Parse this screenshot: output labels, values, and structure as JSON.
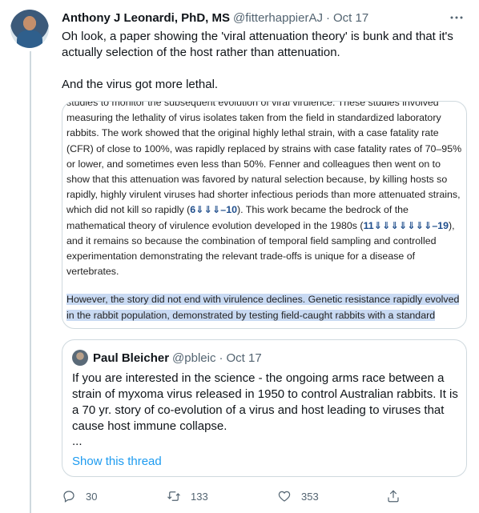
{
  "tweet": {
    "author_name": "Anthony J Leonardi, PhD, MS",
    "author_handle": "@fitterhappierAJ",
    "separator": "·",
    "date": "Oct 17",
    "text_line1": "Oh look, a paper showing the 'viral attenuation theory' is bunk and that it's actually selection of the host rather than attenuation.",
    "text_line2": "And the virus got more lethal."
  },
  "media": {
    "cut_line": "studies to monitor the subsequent evolution of viral virulence. These studies involved",
    "p1_a": "measuring the lethality of virus isolates taken from the field in standardized laboratory rabbits. The work showed that the original highly lethal strain, with a case fatality rate (CFR) of close to 100%, was rapidly replaced by strains with case fatality rates of 70–95% or lower, and sometimes even less than 50%. Fenner and colleagues then went on to show that this attenuation was favored by natural selection because, by killing hosts so rapidly, highly virulent viruses had shorter infectious periods than more attenuated strains, which did not kill so rapidly (",
    "cite1": "6⇓⇓⇓–10",
    "p1_b": "). This work became the bedrock of the mathematical theory of virulence evolution developed in the 1980s (",
    "cite2": "11⇓⇓⇓⇓⇓⇓⇓–19",
    "p1_c": "), and it remains so because the combination of temporal field sampling and controlled experimentation demonstrating the relevant trade-offs is unique for a disease of vertebrates.",
    "p2_highlight": "However, the story did not end with virulence declines. Genetic resistance rapidly evolved in the rabbit population, demonstrated by testing field-caught rabbits with a standard"
  },
  "quote": {
    "author_name": "Paul Bleicher",
    "author_handle": "@pbleic",
    "separator": "·",
    "date": "Oct 17",
    "text": "If you are interested in the science - the ongoing arms race between a strain of myxoma virus released in 1950 to control Australian rabbits.  It is a 70 yr. story of co-evolution of a virus and host leading to viruses that cause host immune collapse.",
    "ellipsis": "...",
    "show_thread": "Show this thread"
  },
  "actions": {
    "reply_count": "30",
    "retweet_count": "133",
    "like_count": "353"
  },
  "icons": {
    "more": "more-horizontal-icon",
    "reply": "reply-icon",
    "retweet": "retweet-icon",
    "like": "heart-icon",
    "share": "share-icon"
  },
  "colors": {
    "link": "#1d9bf0",
    "secondary_text": "#536471",
    "border": "#cfd9de",
    "highlight": "#c9daf3"
  }
}
